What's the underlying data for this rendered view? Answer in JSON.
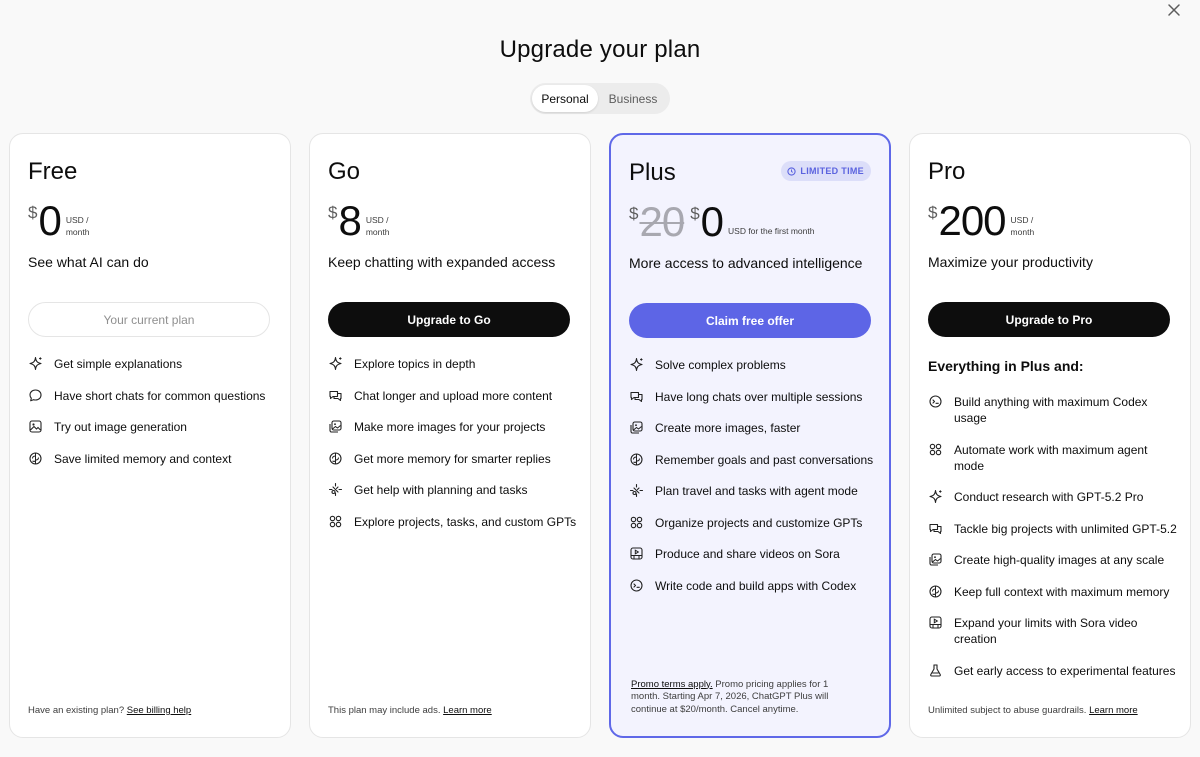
{
  "title": "Upgrade your plan",
  "toggle": {
    "personal": "Personal",
    "business": "Business"
  },
  "colors": {
    "accent": "#5d65e6",
    "plus_bg": "#f3f3fe",
    "dark_button": "#0d0d0d"
  },
  "plans": {
    "free": {
      "name": "Free",
      "currency": "$",
      "price": "0",
      "unit_line1": "USD /",
      "unit_line2": "month",
      "tagline": "See what AI can do",
      "cta": "Your current plan",
      "features": [
        {
          "icon": "sparkle-icon",
          "text": "Get simple explanations"
        },
        {
          "icon": "chat-bubble-icon",
          "text": "Have short chats for common questions"
        },
        {
          "icon": "image-icon",
          "text": "Try out image generation"
        },
        {
          "icon": "memory-icon",
          "text": "Save limited memory and context"
        }
      ],
      "footer_text": "Have an existing plan?",
      "footer_link": "See billing help"
    },
    "go": {
      "name": "Go",
      "currency": "$",
      "price": "8",
      "unit_line1": "USD /",
      "unit_line2": "month",
      "tagline": "Keep chatting with expanded access",
      "cta": "Upgrade to Go",
      "features": [
        {
          "icon": "sparkle-icon",
          "text": "Explore topics in depth"
        },
        {
          "icon": "chats-icon",
          "text": "Chat longer and upload more content"
        },
        {
          "icon": "images-icon",
          "text": "Make more images for your projects"
        },
        {
          "icon": "memory-icon",
          "text": "Get more memory for smarter replies"
        },
        {
          "icon": "agent-icon",
          "text": "Get help with planning and tasks"
        },
        {
          "icon": "gpts-icon",
          "text": "Explore projects, tasks, and custom GPTs"
        }
      ],
      "footer_text": "This plan may include ads.",
      "footer_link": "Learn more"
    },
    "plus": {
      "name": "Plus",
      "badge": "LIMITED TIME",
      "currency": "$",
      "old_price": "20",
      "price": "0",
      "unit_single": "USD for the first month",
      "tagline": "More access to advanced intelligence",
      "cta": "Claim free offer",
      "features": [
        {
          "icon": "sparkle-icon",
          "text": "Solve complex problems"
        },
        {
          "icon": "chats-icon",
          "text": "Have long chats over multiple sessions"
        },
        {
          "icon": "images-icon",
          "text": "Create more images, faster"
        },
        {
          "icon": "memory-icon",
          "text": "Remember goals and past conversations"
        },
        {
          "icon": "agent-icon",
          "text": "Plan travel and tasks with agent mode"
        },
        {
          "icon": "gpts-icon",
          "text": "Organize projects and customize GPTs"
        },
        {
          "icon": "video-icon",
          "text": "Produce and share videos on Sora"
        },
        {
          "icon": "codex-icon",
          "text": "Write code and build apps with Codex"
        }
      ],
      "footer_link": "Promo terms apply.",
      "footer_text": "Promo pricing applies for 1 month. Starting Apr 7, 2026, ChatGPT Plus will continue at $20/month. Cancel anytime."
    },
    "pro": {
      "name": "Pro",
      "currency": "$",
      "price": "200",
      "unit_line1": "USD /",
      "unit_line2": "month",
      "tagline": "Maximize your productivity",
      "cta": "Upgrade to Pro",
      "heading": "Everything in Plus and:",
      "features": [
        {
          "icon": "codex-icon",
          "text": "Build anything with maximum Codex usage"
        },
        {
          "icon": "gpts-icon",
          "text": "Automate work with maximum agent mode"
        },
        {
          "icon": "sparkle-icon",
          "text": "Conduct research with GPT-5.2 Pro"
        },
        {
          "icon": "chats-icon",
          "text": "Tackle big projects with unlimited GPT-5.2"
        },
        {
          "icon": "images-icon",
          "text": "Create high-quality images at any scale"
        },
        {
          "icon": "memory-icon",
          "text": "Keep full context with maximum memory"
        },
        {
          "icon": "video-icon",
          "text": "Expand your limits with Sora video creation"
        },
        {
          "icon": "flask-icon",
          "text": "Get early access to experimental features"
        }
      ],
      "footer_text": "Unlimited subject to abuse guardrails.",
      "footer_link": "Learn more"
    }
  }
}
